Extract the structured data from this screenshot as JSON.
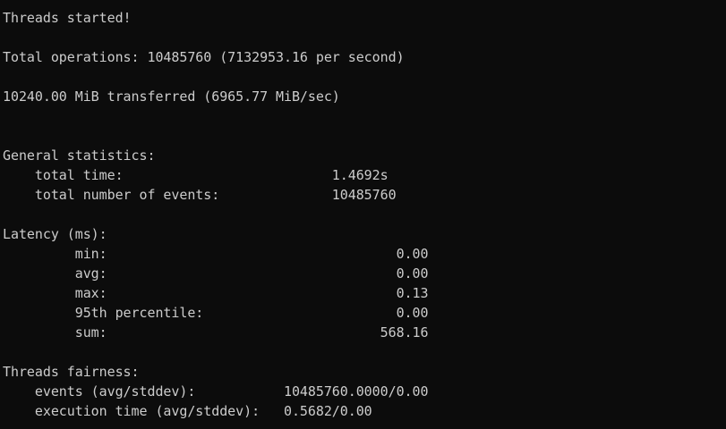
{
  "terminal": {
    "lines": [
      "Threads started!",
      "",
      "Total operations: 10485760 (7132953.16 per second)",
      "",
      "10240.00 MiB transferred (6965.77 MiB/sec)",
      "",
      "",
      "General statistics:",
      "    total time:                          1.4692s",
      "    total number of events:              10485760",
      "",
      "Latency (ms):",
      "         min:                                    0.00",
      "         avg:                                    0.00",
      "         max:                                    0.13",
      "         95th percentile:                        0.00",
      "         sum:                                  568.16",
      "",
      "Threads fairness:",
      "    events (avg/stddev):           10485760.0000/0.00",
      "    execution time (avg/stddev):   0.5682/0.00"
    ],
    "colors": {
      "background": "#0c0c0c",
      "text": "#cccccc"
    }
  }
}
